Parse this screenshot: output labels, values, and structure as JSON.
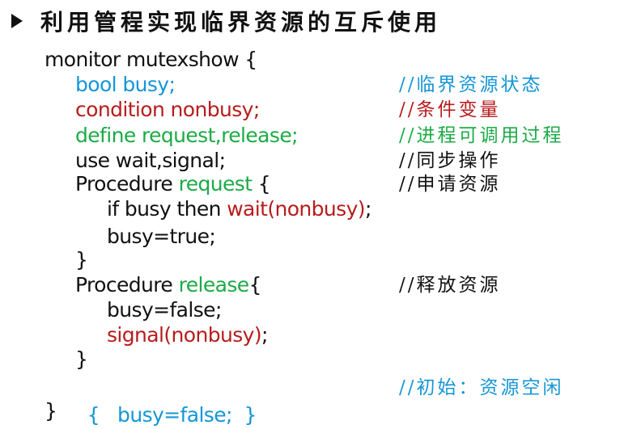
{
  "title": "利用管程实现临界资源的互斥使用",
  "colors": {
    "default": "#111111",
    "blue": "#1596d6",
    "red": "#b81c1c",
    "green": "#1cab46"
  },
  "bullet_icon": "arrow-bullet-icon",
  "code": {
    "l1": "monitor mutexshow {",
    "l2": "bool busy;",
    "l3": "condition nonbusy;",
    "l4": "define request,release;",
    "l5": "use wait,signal;",
    "l6_a": "Procedure ",
    "l6_b": "request",
    "l6_c": " {",
    "l7_a": "if busy then ",
    "l7_b": "wait(nonbusy)",
    "l7_c": ";",
    "l8": "busy=true;",
    "l9": "}",
    "l10_a": "Procedure ",
    "l10_b": "release",
    "l10_c": "{",
    "l11": "busy=false;",
    "l12_a": "signal(nonbusy)",
    "l12_b": ";",
    "l13": "}",
    "l14": "{   busy=false;  }",
    "l15": "}"
  },
  "comments": {
    "c2": "//临界资源状态",
    "c3": "//条件变量",
    "c4": "//进程可调用过程",
    "c5": "//同步操作",
    "c6": "//申请资源",
    "c10": "//释放资源",
    "c14": "//初始：资源空闲"
  }
}
